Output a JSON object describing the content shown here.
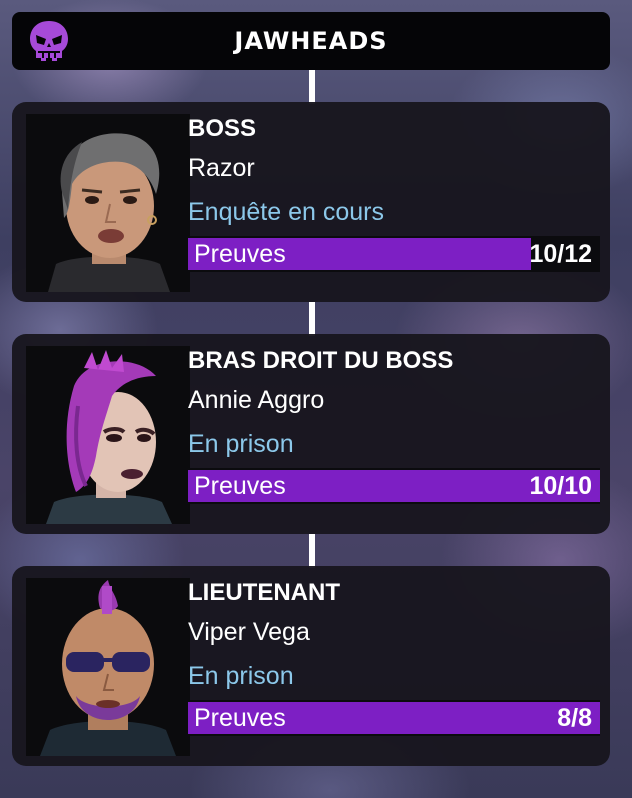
{
  "gang": {
    "title": "JAWHEADS",
    "icon": "purple-skull-icon"
  },
  "colors": {
    "evidence_fill": "#7d1fc4",
    "status_text": "#8cc8ea",
    "card_bg": "#18161e"
  },
  "members": [
    {
      "role": "BOSS",
      "name": "Razor",
      "status": "Enquête en cours",
      "evidence_label": "Preuves",
      "evidence_count": "10/12",
      "evidence_progress": 0.833,
      "portrait": "razor-portrait"
    },
    {
      "role": "BRAS DROIT DU BOSS",
      "name": "Annie Aggro",
      "status": "En prison",
      "evidence_label": "Preuves",
      "evidence_count": "10/10",
      "evidence_progress": 1.0,
      "portrait": "annie-aggro-portrait"
    },
    {
      "role": "LIEUTENANT",
      "name": "Viper Vega",
      "status": "En prison",
      "evidence_label": "Preuves",
      "evidence_count": "8/8",
      "evidence_progress": 1.0,
      "portrait": "viper-vega-portrait"
    }
  ]
}
